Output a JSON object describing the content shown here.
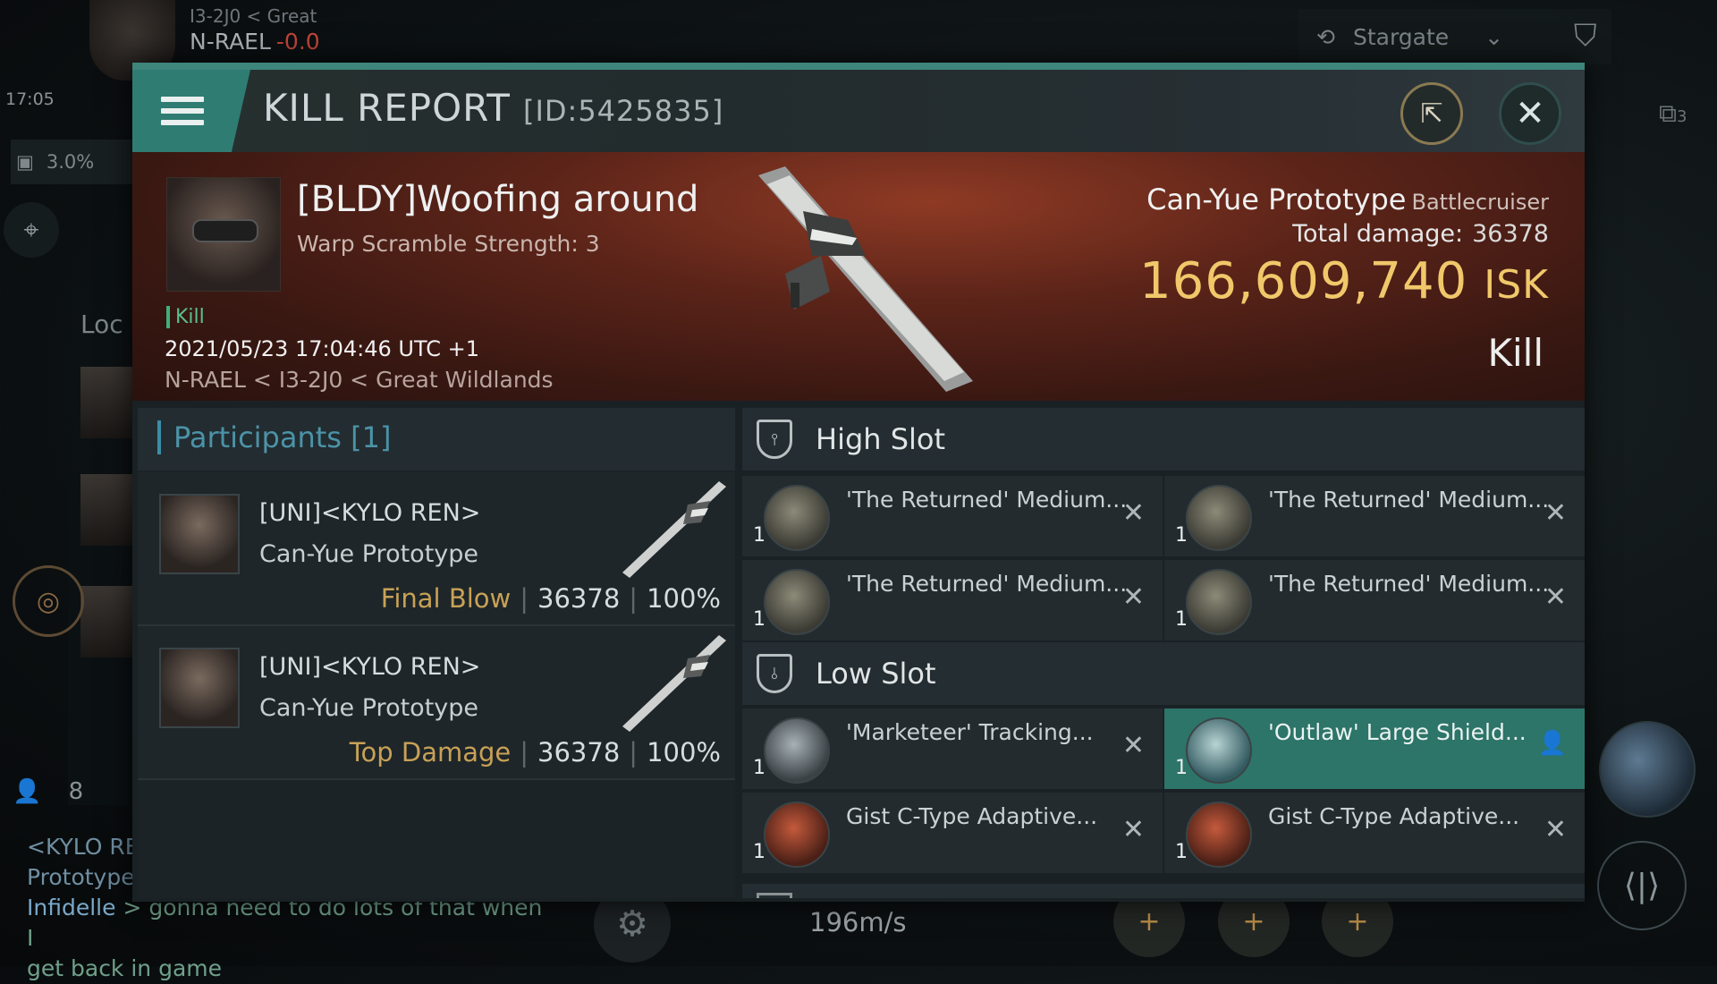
{
  "hud": {
    "location_parent": "I3-2J0 < Great",
    "location_system": "N-RAEL",
    "security": "-0.0",
    "time": "17:05",
    "cargo_percent": "3.0%",
    "local_tab": "Loc",
    "stargate_label": "Stargate",
    "right_badge": "3",
    "member_count": "8",
    "speed": "196m/s",
    "chat": [
      {
        "name": "<KYLO RE",
        "text": ""
      },
      {
        "name": "",
        "text": "Prototype"
      },
      {
        "name": "Infidelle",
        "text": " > gonna need to do lots of that when I"
      },
      {
        "name": "",
        "text": "get back in game"
      }
    ]
  },
  "window": {
    "title": "KILL REPORT",
    "report_id": "[ID:5425835]"
  },
  "victim": {
    "name": "[BLDY]Woofing around",
    "subtitle": "Warp Scramble Strength: 3",
    "tag": "Kill",
    "datetime": "2021/05/23 17:04:46 UTC +1",
    "location": "N-RAEL < I3-2J0 < Great Wildlands",
    "ship_name": "Can-Yue Prototype",
    "ship_class": "Battlecruiser",
    "total_damage_label": "Total damage:",
    "total_damage": "36378",
    "isk_value": "166,609,740",
    "isk_unit": "ISK",
    "status": "Kill"
  },
  "participants": {
    "header": "Participants [1]",
    "rows": [
      {
        "name": "[UNI]<KYLO REN>",
        "ship": "Can-Yue Prototype",
        "role": "Final Blow",
        "damage": "36378",
        "percent": "100%"
      },
      {
        "name": "[UNI]<KYLO REN>",
        "ship": "Can-Yue Prototype",
        "role": "Top Damage",
        "damage": "36378",
        "percent": "100%"
      }
    ]
  },
  "fittings": {
    "high_slot_label": "High Slot",
    "low_slot_label": "Low Slot",
    "high_slot": [
      {
        "name": "'The Returned' Medium...",
        "qty": "1"
      },
      {
        "name": "'The Returned' Medium...",
        "qty": "1"
      },
      {
        "name": "'The Returned' Medium...",
        "qty": "1"
      },
      {
        "name": "'The Returned' Medium...",
        "qty": "1"
      }
    ],
    "low_slot": [
      {
        "name": "'Marketeer' Tracking...",
        "qty": "1"
      },
      {
        "name": "'Outlaw' Large Shield...",
        "qty": "1"
      },
      {
        "name": "Gist C-Type Adaptive...",
        "qty": "1"
      },
      {
        "name": "Gist C-Type Adaptive...",
        "qty": "1"
      }
    ]
  },
  "colors": {
    "accent_teal": "#2f7c73",
    "isk_gold": "#f0c86a",
    "banner_red": "#5c2419",
    "kill_green": "#3fb17a"
  }
}
